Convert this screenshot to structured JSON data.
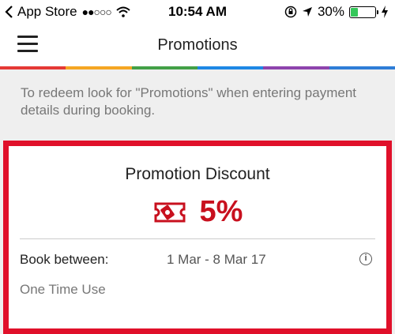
{
  "status_bar": {
    "carrier": "App Store",
    "signal": "●●○○○",
    "time": "10:54 AM",
    "battery_text": "30%",
    "battery_level": 0.3,
    "battery_color": "#34c759"
  },
  "nav": {
    "title": "Promotions"
  },
  "rainbow_colors": [
    "#e53935",
    "#f5a623",
    "#43a047",
    "#1e88e5",
    "#8e44ad",
    "#2e7dd7"
  ],
  "info": {
    "text": "To redeem look for \"Promotions\" when entering payment details during booking."
  },
  "promo_card": {
    "border_color": "#e0102a",
    "title": "Promotion Discount",
    "discount": "5%",
    "book_between_label": "Book between:",
    "book_between_value": "1 Mar - 8 Mar 17",
    "usage": "One Time Use"
  }
}
